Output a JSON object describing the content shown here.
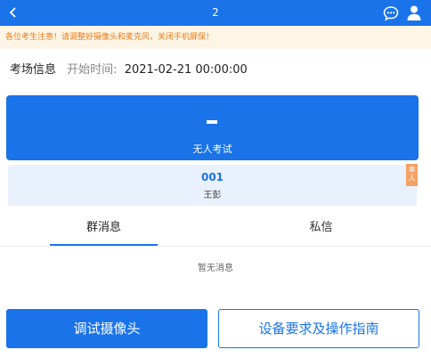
{
  "header": {
    "title": "2",
    "back_icon": "chevron-left-icon",
    "chat_icon": "chat-bubble-icon",
    "user_icon": "user-icon",
    "bg_color": "#1a73e8"
  },
  "notice": {
    "text": "各位考生注意！请调整好摄像头和麦克风，关闭手机屏保！",
    "color": "#ee7a1a"
  },
  "exam_info": {
    "label": "考场信息",
    "start_label": "开始时间:",
    "start_time": "2021-02-21 00:00:00"
  },
  "exam_card": {
    "value": "-",
    "name": "无人考试"
  },
  "seat": {
    "number": "001",
    "name": "王彭",
    "badge": "本人"
  },
  "tabs": [
    {
      "label": "群消息",
      "active": true
    },
    {
      "label": "私信",
      "active": false
    }
  ],
  "messages": {
    "empty_text": "暂无消息"
  },
  "actions": {
    "camera_label": "调试摄像头",
    "guide_label": "设备要求及操作指南"
  }
}
